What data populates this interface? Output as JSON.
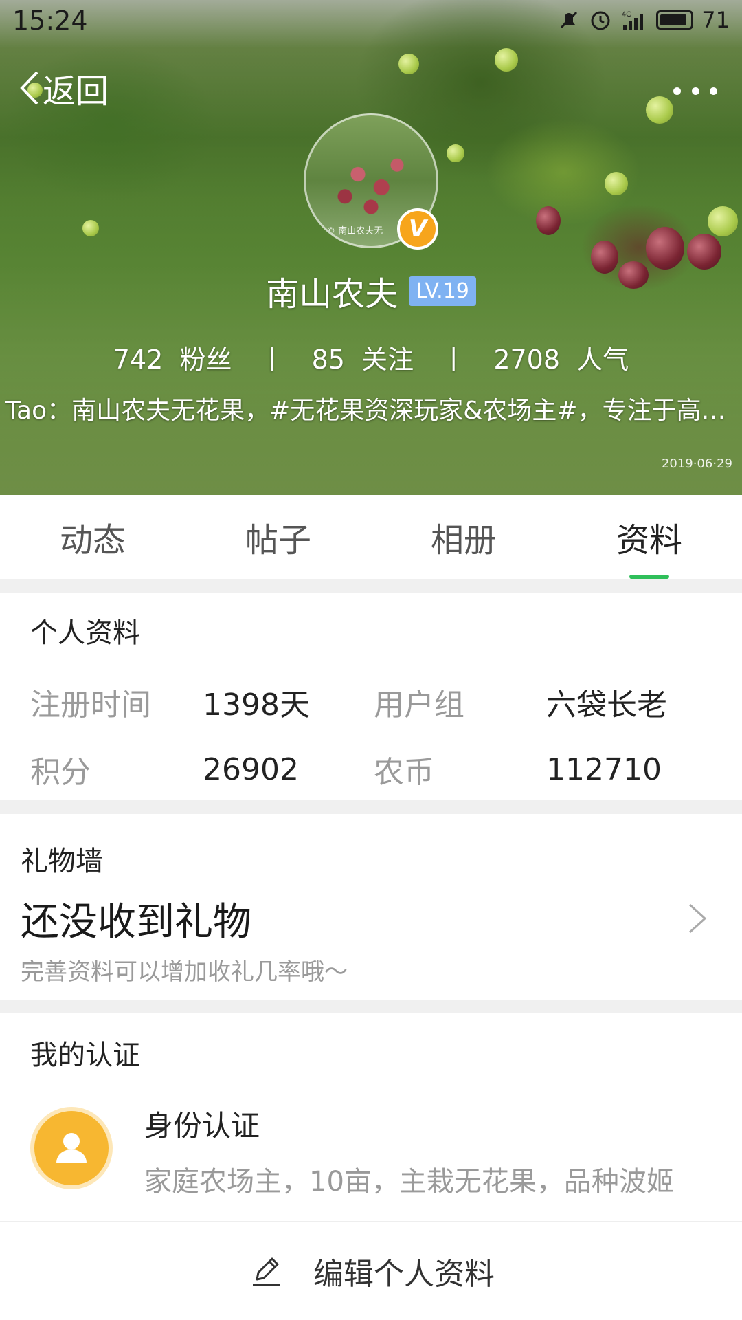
{
  "status_bar": {
    "time": "15:24",
    "network": "4G",
    "battery": "71"
  },
  "nav": {
    "back_label": "返回"
  },
  "profile_header": {
    "avatar_watermark": "© 南山农夫无",
    "verified_badge": "V",
    "name": "南山农夫",
    "level": "LV.19",
    "stats": {
      "fans_count": "742",
      "fans_label": "粉丝",
      "follow_count": "85",
      "follow_label": "关注",
      "popularity_count": "2708",
      "popularity_label": "人气",
      "separator": "|"
    },
    "bio": "Tao：南山农夫无花果，#无花果资深玩家&农场主#，专注于高…",
    "photo_date": "2019·06·29"
  },
  "tabs": [
    {
      "label": "动态",
      "active": false
    },
    {
      "label": "帖子",
      "active": false
    },
    {
      "label": "相册",
      "active": false
    },
    {
      "label": "资料",
      "active": true
    }
  ],
  "personal_info": {
    "title": "个人资料",
    "register_label": "注册时间",
    "register_value": "1398天",
    "group_label": "用户组",
    "group_value": "六袋长老",
    "points_label": "积分",
    "points_value": "26902",
    "coins_label": "农币",
    "coins_value": "112710"
  },
  "gift_wall": {
    "title": "礼物墙",
    "main": "还没收到礼物",
    "sub": "完善资料可以增加收礼几率哦～"
  },
  "certification": {
    "title": "我的认证",
    "name": "身份认证",
    "desc": "家庭农场主，10亩，主栽无花果，品种波姬"
  },
  "bottom": {
    "edit_label": "编辑个人资料"
  },
  "colors": {
    "accent_green": "#2fbf5a",
    "badge_orange": "#f7a51c",
    "level_blue": "#7fb2f2",
    "cert_yellow": "#f7b731"
  }
}
